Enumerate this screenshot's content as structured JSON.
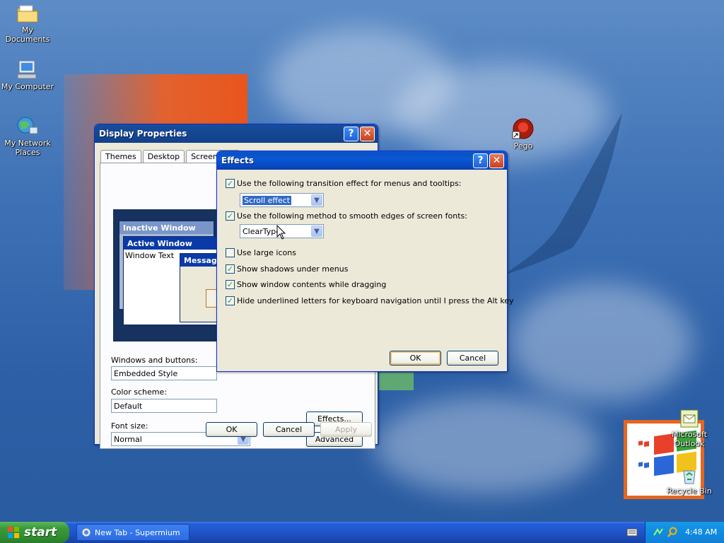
{
  "desktop": {
    "icons": [
      {
        "label": "My Documents",
        "icon": "folder-icon"
      },
      {
        "label": "My Computer",
        "icon": "computer-icon"
      },
      {
        "label": "My Network Places",
        "icon": "network-places-icon"
      },
      {
        "label": "Pego",
        "icon": "pego-shortcut-icon"
      },
      {
        "label": "Microsoft Outlook",
        "icon": "outlook-icon"
      },
      {
        "label": "Recycle Bin",
        "icon": "recycle-bin-icon"
      }
    ]
  },
  "display_properties": {
    "title": "Display Properties",
    "help_glyph": "?",
    "close_glyph": "✕",
    "tabs": [
      "Themes",
      "Desktop",
      "Screen Sav"
    ],
    "preview": {
      "inactive_title": "Inactive Window",
      "active_title": "Active Window",
      "window_text": "Window Text",
      "message_title": "Message"
    },
    "windows_buttons_label": "Windows and buttons:",
    "windows_buttons_value": "Embedded Style",
    "color_scheme_label": "Color scheme:",
    "color_scheme_value": "Default",
    "font_size_label": "Font size:",
    "font_size_value": "Normal",
    "effects_button": "Effects...",
    "advanced_button": "Advanced",
    "ok_button": "OK",
    "cancel_button": "Cancel",
    "apply_button": "Apply"
  },
  "effects": {
    "title": "Effects",
    "help_glyph": "?",
    "close_glyph": "✕",
    "transition_checkbox": "Use the following transition effect for menus and tooltips:",
    "transition_value": "Scroll effect",
    "smooth_checkbox": "Use the following method to smooth edges of screen fonts:",
    "smooth_value": "ClearType",
    "large_icons": "Use large icons",
    "shadows": "Show shadows under menus",
    "window_contents": "Show window contents while dragging",
    "hide_underlines": "Hide underlined letters for keyboard navigation until I press the Alt key",
    "checked": {
      "transition": true,
      "smooth": true,
      "large_icons": false,
      "shadows": true,
      "window_contents": true,
      "hide_underlines": true
    },
    "ok_button": "OK",
    "cancel_button": "Cancel"
  },
  "taskbar": {
    "start_label": "start",
    "task_label": "New Tab - Supermium",
    "clock": "4:48 AM"
  },
  "check_glyph": "✓",
  "arrow_glyph": "▼"
}
